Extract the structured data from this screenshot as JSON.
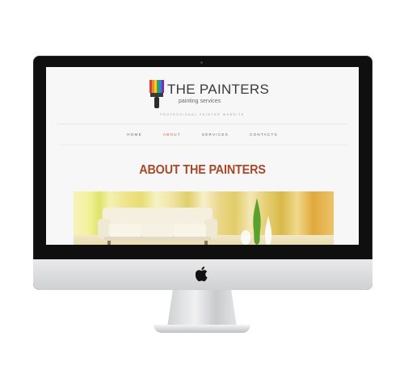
{
  "site": {
    "brand_title": "THE PAINTERS",
    "brand_subtitle": "painting services",
    "tagline": "PROFESSIONAL PAINTER WEBSITE",
    "nav": [
      {
        "label": "HOME",
        "active": false
      },
      {
        "label": "ABOUT",
        "active": true
      },
      {
        "label": "SERVICES",
        "active": false
      },
      {
        "label": "CONTACTS",
        "active": false
      }
    ],
    "page_heading": "ABOUT THE PAINTERS"
  },
  "colors": {
    "accent": "#d1572f",
    "heading": "#a8482b",
    "bezel": "#0f0f10",
    "screen_bg": "#f7f7f7"
  },
  "icons": {
    "logo": "paintbrush-logo-icon",
    "device": "apple-logo-icon"
  }
}
